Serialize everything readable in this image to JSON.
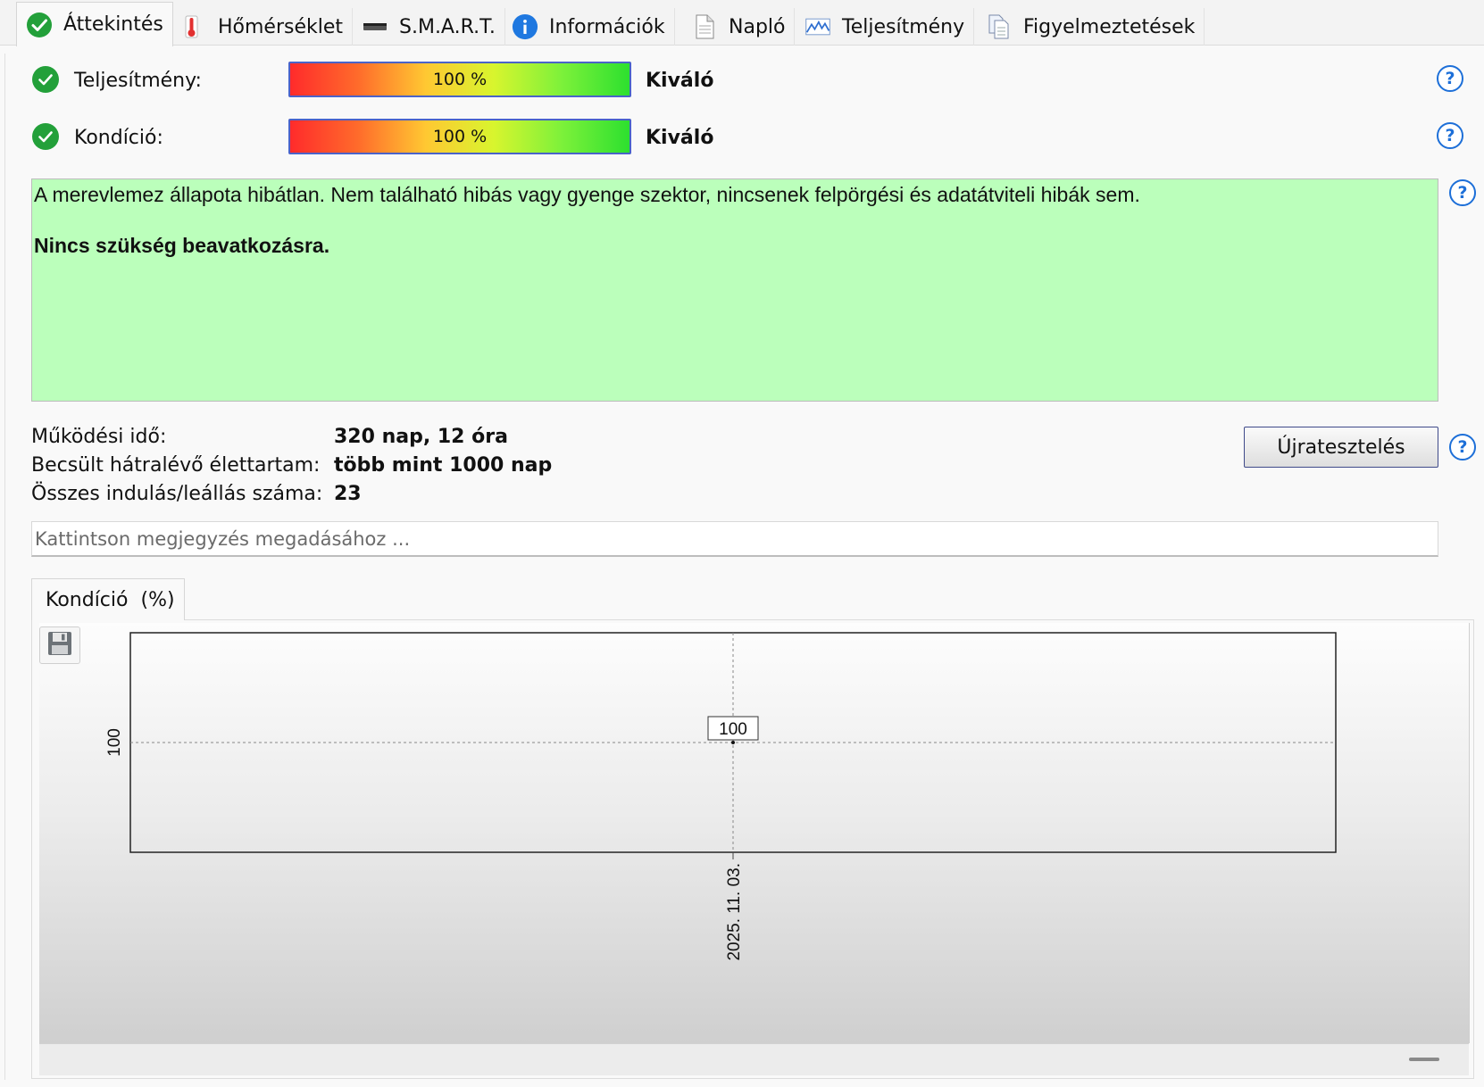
{
  "tabs": [
    {
      "label": "Áttekintés",
      "icon": "check-circle-icon",
      "active": true
    },
    {
      "label": "Hőmérséklet",
      "icon": "thermometer-icon",
      "active": false
    },
    {
      "label": "S.M.A.R.T.",
      "icon": "disk-drive-icon",
      "active": false
    },
    {
      "label": "Információk",
      "icon": "info-icon",
      "active": false
    },
    {
      "label": "Napló",
      "icon": "document-icon",
      "active": false
    },
    {
      "label": "Teljesítmény",
      "icon": "performance-chart-icon",
      "active": false
    },
    {
      "label": "Figyelmeztetések",
      "icon": "copy-documents-icon",
      "active": false
    }
  ],
  "status": {
    "performance": {
      "label": "Teljesítmény:",
      "value": 100,
      "value_text": "100 %",
      "verdict": "Kiváló"
    },
    "condition": {
      "label": "Kondíció:",
      "value": 100,
      "value_text": "100 %",
      "verdict": "Kiváló"
    }
  },
  "message": {
    "text": "A merevlemez állapota hibátlan. Nem található hibás vagy gyenge szektor, nincsenek felpörgési és adatátviteli hibák sem.",
    "recommendation": "Nincs szükség beavatkozásra."
  },
  "info": {
    "uptime_label": "Működési idő:",
    "uptime_value": "320 nap, 12 óra",
    "lifetime_label": "Becsült hátralévő élettartam:",
    "lifetime_value": "több mint 1000 nap",
    "startstop_label": "Összes indulás/leállás száma:",
    "startstop_value": "23"
  },
  "retest_label": "Újratesztelés",
  "note_placeholder": "Kattintson megjegyzés megadásához ...",
  "chart_tab": {
    "label": "Kondíció",
    "unit": "(%)"
  },
  "colors": {
    "accent_blue": "#1d6fd8",
    "ok_green": "#23a03a",
    "message_bg": "#bbffbb",
    "bar_border": "#4a63c9"
  },
  "chart_data": {
    "type": "line",
    "title": "",
    "xlabel": "",
    "ylabel": "",
    "x": [
      "2025. 11. 03."
    ],
    "series": [
      {
        "values": [
          100
        ]
      }
    ],
    "x_tick_labels": [
      "2025. 11. 03."
    ],
    "y_tick_labels": [
      "100"
    ],
    "data_labels": [
      "100"
    ],
    "ylim": [
      0,
      200
    ],
    "grid": true,
    "legend": "none"
  }
}
